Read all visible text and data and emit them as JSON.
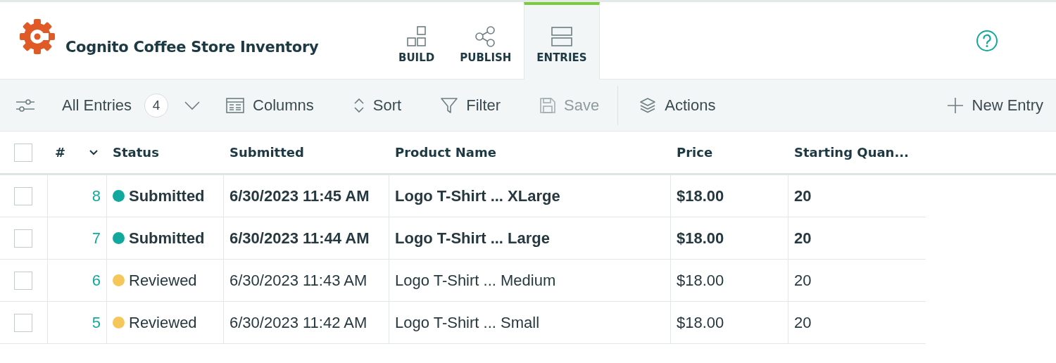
{
  "app": {
    "title": "Cognito Coffee Store Inventory"
  },
  "tabs": [
    {
      "kind": "build",
      "label": "BUILD",
      "selected": false
    },
    {
      "kind": "publish",
      "label": "PUBLISH",
      "selected": false
    },
    {
      "kind": "entries",
      "label": "ENTRIES",
      "selected": true
    }
  ],
  "toolbar": {
    "view": {
      "label": "All Entries",
      "count": "4"
    },
    "items": [
      {
        "kind": "columns",
        "label": "Columns",
        "disabled": false
      },
      {
        "kind": "sort",
        "label": "Sort",
        "disabled": false
      },
      {
        "kind": "filter",
        "label": "Filter",
        "disabled": false
      },
      {
        "kind": "save",
        "label": "Save",
        "disabled": true
      },
      {
        "kind": "actions",
        "label": "Actions",
        "disabled": false
      }
    ],
    "new_entry": {
      "label": "New Entry"
    }
  },
  "table": {
    "select_all_checked": false,
    "columns": [
      "#",
      "Status",
      "Submitted",
      "Product Name",
      "Price",
      "Starting Quan..."
    ],
    "rows": [
      {
        "checked": false,
        "unread": true,
        "number": "8",
        "status": "Submitted",
        "color": "#13a89e",
        "submitted": "6/30/2023 11:45 AM",
        "product": "Logo T-Shirt ... XLarge",
        "price": "$18.00",
        "quantity": "20"
      },
      {
        "checked": false,
        "unread": true,
        "number": "7",
        "status": "Submitted",
        "color": "#13a89e",
        "submitted": "6/30/2023 11:44 AM",
        "product": "Logo T-Shirt ... Large",
        "price": "$18.00",
        "quantity": "20"
      },
      {
        "checked": false,
        "unread": false,
        "number": "6",
        "status": "Reviewed",
        "color": "#f5c75a",
        "submitted": "6/30/2023 11:43 AM",
        "product": "Logo T-Shirt ... Medium",
        "price": "$18.00",
        "quantity": "20"
      },
      {
        "checked": false,
        "unread": false,
        "number": "5",
        "status": "Reviewed",
        "color": "#f5c75a",
        "submitted": "6/30/2023 11:42 AM",
        "product": "Logo T-Shirt ... Small",
        "price": "$18.00",
        "quantity": "20"
      }
    ]
  }
}
